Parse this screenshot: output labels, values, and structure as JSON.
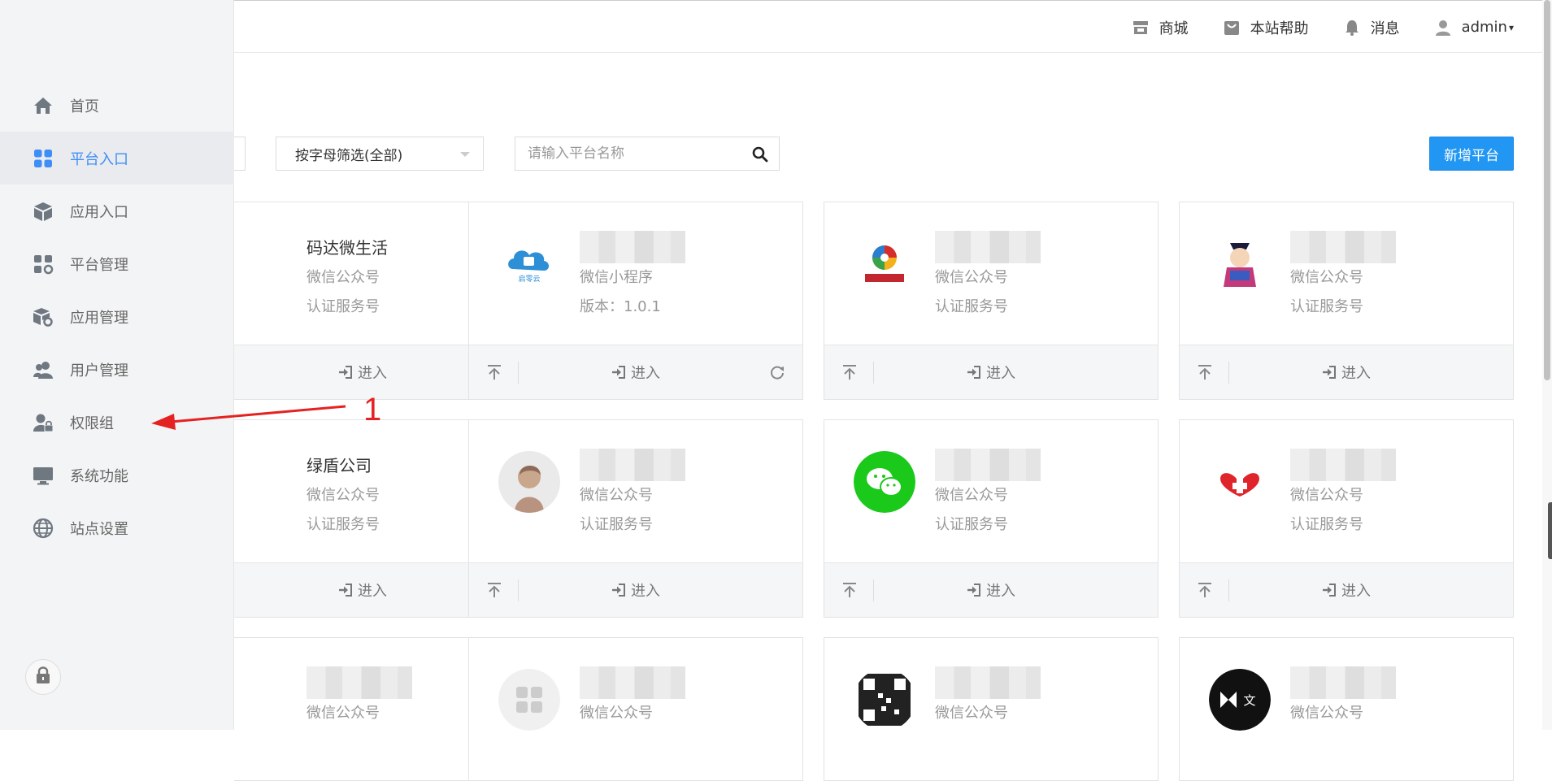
{
  "topnav": {
    "items": [
      {
        "label": "商城",
        "icon": "shop-icon"
      },
      {
        "label": "本站帮助",
        "icon": "help-bag-icon"
      },
      {
        "label": "消息",
        "icon": "bell-icon"
      },
      {
        "label": "admin",
        "icon": "user-icon"
      }
    ]
  },
  "sidebar": {
    "items": [
      {
        "label": "首页",
        "icon": "home-icon"
      },
      {
        "label": "平台入口",
        "icon": "grid-icon",
        "active": true
      },
      {
        "label": "应用入口",
        "icon": "cube-icon"
      },
      {
        "label": "平台管理",
        "icon": "platform-gear-icon"
      },
      {
        "label": "应用管理",
        "icon": "app-gear-icon"
      },
      {
        "label": "用户管理",
        "icon": "users-icon"
      },
      {
        "label": "权限组",
        "icon": "user-lock-icon"
      },
      {
        "label": "系统功能",
        "icon": "monitor-icon"
      },
      {
        "label": "站点设置",
        "icon": "globe-icon"
      }
    ]
  },
  "toolbar": {
    "letter_filter": "按字母筛选(全部)",
    "search_placeholder": "请输入平台名称",
    "add_label": "新增平台"
  },
  "cards": [
    {
      "name": "码达微生活",
      "type": "微信公众号",
      "sub": "认证服务号",
      "enter": "进入"
    },
    {
      "name": "",
      "type": "微信小程序",
      "sub": "版本：1.0.1",
      "enter": "进入"
    },
    {
      "name": "",
      "type": "微信公众号",
      "sub": "认证服务号",
      "enter": "进入"
    },
    {
      "name": "",
      "type": "微信公众号",
      "sub": "认证服务号",
      "enter": "进入"
    },
    {
      "name": "绿盾公司",
      "type": "微信公众号",
      "sub": "认证服务号",
      "enter": "进入"
    },
    {
      "name": "",
      "type": "微信公众号",
      "sub": "认证服务号",
      "enter": "进入"
    },
    {
      "name": "",
      "type": "微信公众号",
      "sub": "认证服务号",
      "enter": "进入"
    },
    {
      "name": "",
      "type": "微信公众号",
      "sub": "认证服务号",
      "enter": "进入"
    },
    {
      "name": "",
      "type": "微信公众号",
      "sub": "",
      "enter": ""
    },
    {
      "name": "",
      "type": "微信公众号",
      "sub": "",
      "enter": ""
    },
    {
      "name": "",
      "type": "微信公众号",
      "sub": "",
      "enter": ""
    },
    {
      "name": "",
      "type": "微信公众号",
      "sub": "",
      "enter": ""
    }
  ],
  "annotation": {
    "label": "1"
  }
}
